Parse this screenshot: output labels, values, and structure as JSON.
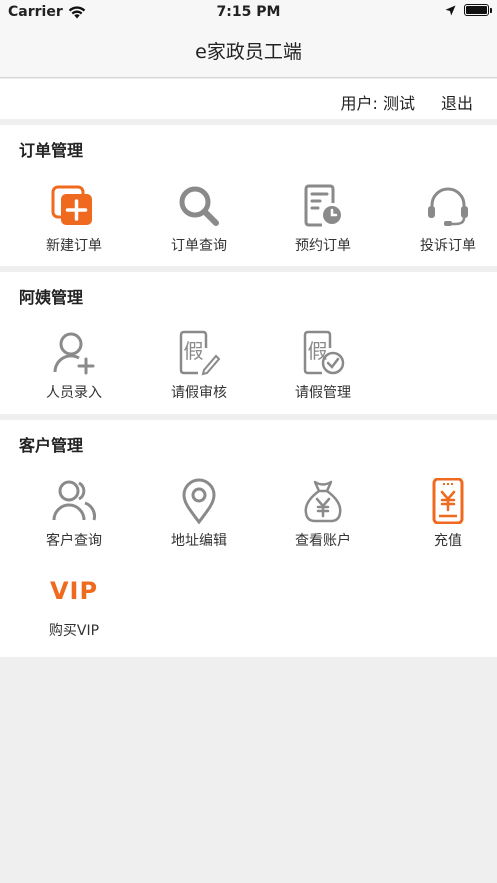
{
  "status": {
    "carrier": "Carrier",
    "time": "7:15 PM"
  },
  "nav": {
    "title": "e家政员工端"
  },
  "user_bar": {
    "user_label": "用户: 测试",
    "logout_label": "退出"
  },
  "sections": {
    "orders": {
      "title": "订单管理",
      "items": [
        {
          "label": "新建订单",
          "icon": "new-order-icon"
        },
        {
          "label": "订单查询",
          "icon": "search-icon"
        },
        {
          "label": "预约订单",
          "icon": "schedule-order-icon"
        },
        {
          "label": "投诉订单",
          "icon": "headset-icon"
        }
      ]
    },
    "aunties": {
      "title": "阿姨管理",
      "items": [
        {
          "label": "人员录入",
          "icon": "add-person-icon"
        },
        {
          "label": "请假审核",
          "icon": "leave-review-icon"
        },
        {
          "label": "请假管理",
          "icon": "leave-manage-icon"
        }
      ]
    },
    "customers": {
      "title": "客户管理",
      "items": [
        {
          "label": "客户查询",
          "icon": "customers-icon"
        },
        {
          "label": "地址编辑",
          "icon": "location-pin-icon"
        },
        {
          "label": "查看账户",
          "icon": "money-bag-icon"
        },
        {
          "label": "充值",
          "icon": "phone-recharge-icon"
        },
        {
          "label": "购买VIP",
          "icon": "vip-icon",
          "badge": "VIP"
        }
      ]
    }
  },
  "icon_glyphs": {
    "leave": "假"
  },
  "colors": {
    "accent": "#ef6a1f",
    "icon_gray": "#8a8a8a",
    "background": "#efefef"
  }
}
